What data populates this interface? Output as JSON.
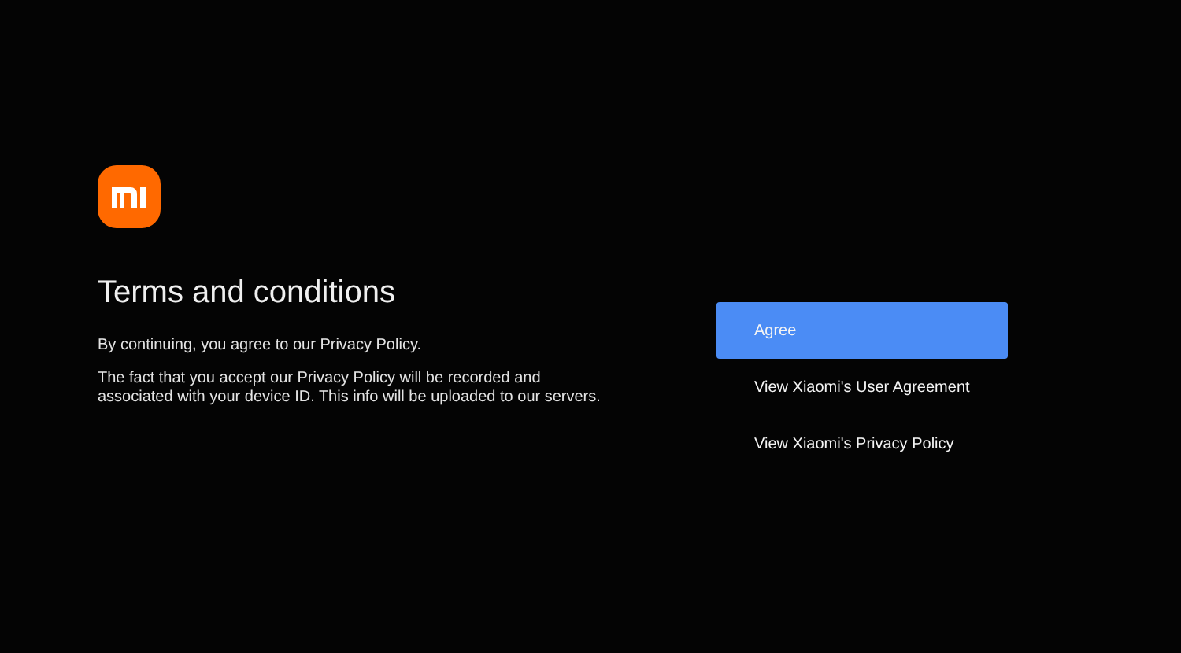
{
  "title": "Terms and conditions",
  "paragraphs": [
    "By continuing, you agree to our Privacy Policy.",
    "The fact that you accept our Privacy Policy will be recorded and associated with your device ID. This info will be uploaded to our servers."
  ],
  "options": [
    {
      "label": "Agree",
      "selected": true
    },
    {
      "label": "View Xiaomi's User Agreement",
      "selected": false
    },
    {
      "label": "View Xiaomi's Privacy Policy",
      "selected": false
    }
  ]
}
